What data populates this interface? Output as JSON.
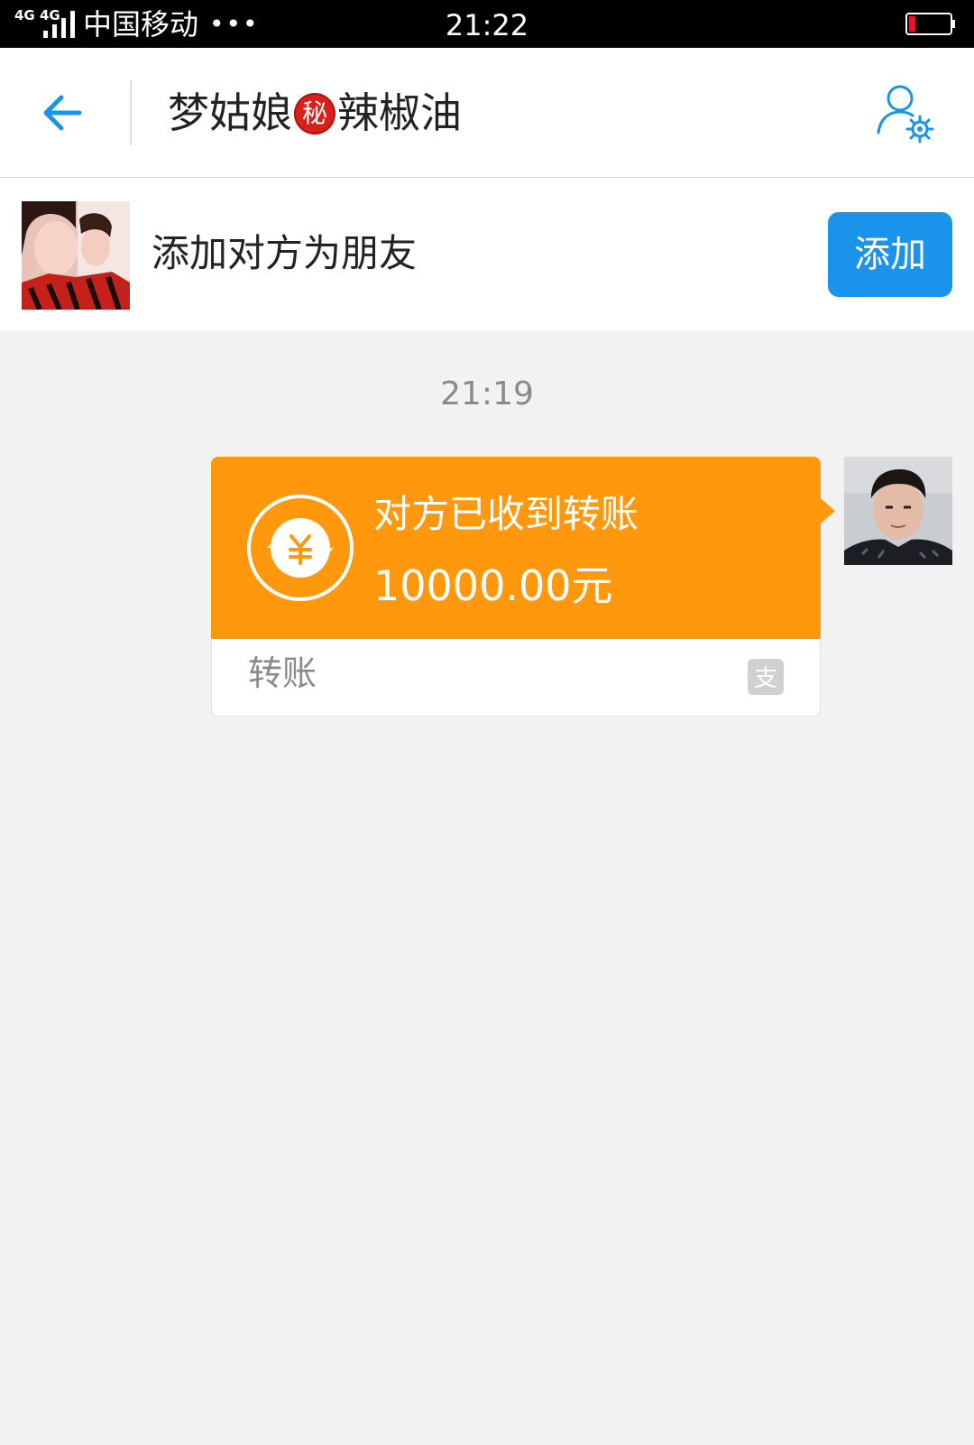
{
  "status_bar": {
    "network": "4G 4G",
    "carrier": "中国移动",
    "more": "•••",
    "time": "21:22"
  },
  "header": {
    "title_part1": "梦姑娘",
    "title_badge": "秘",
    "title_part2": "辣椒油"
  },
  "add_friend": {
    "prompt": "添加对方为朋友",
    "button_label": "添加"
  },
  "chat": {
    "time": "21:19",
    "transfer": {
      "status": "对方已收到转账",
      "amount": "10000.00元",
      "type_label": "转账",
      "alipay_icon_label": "支"
    }
  },
  "colors": {
    "accent_blue": "#1a94ea",
    "transfer_orange": "#ff980c",
    "background": "#f2f2f2",
    "battery_low": "#e8152a"
  },
  "icons": {
    "back": "back-arrow-icon",
    "profile_settings": "profile-settings-icon",
    "transfer": "yuan-transfer-icon",
    "alipay": "alipay-icon",
    "battery": "battery-icon",
    "signal": "signal-icon"
  }
}
